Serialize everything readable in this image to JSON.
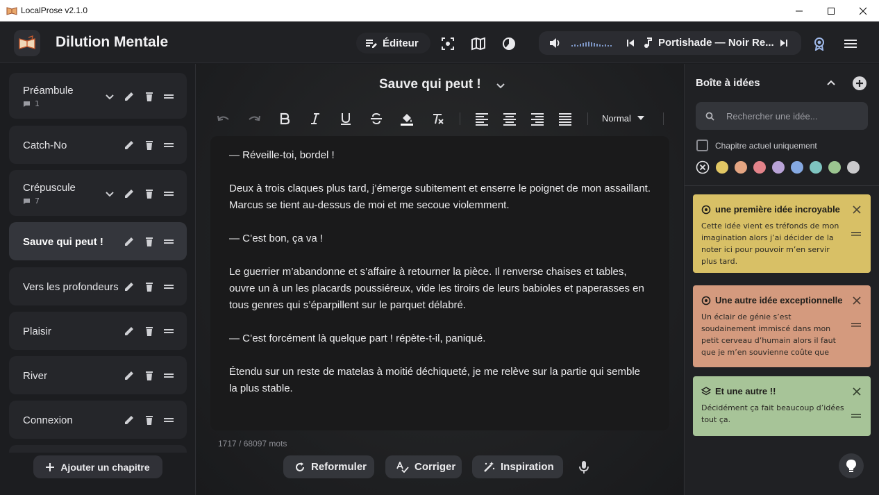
{
  "window": {
    "title": "LocalProse v2.1.0"
  },
  "header": {
    "project_title": "Dilution Mentale",
    "editor_label": "Éditeur",
    "player": {
      "track": "Portishade — Noir Re..."
    }
  },
  "sidebar": {
    "chapters": [
      {
        "name": "Préambule",
        "count": "1",
        "expandable": true
      },
      {
        "name": "Catch-No",
        "count": null,
        "expandable": false
      },
      {
        "name": "Crépuscule",
        "count": "7",
        "expandable": true
      },
      {
        "name": "Sauve qui peut !",
        "count": null,
        "expandable": false,
        "active": true
      },
      {
        "name": "Vers les profondeurs",
        "count": null,
        "expandable": false
      },
      {
        "name": "Plaisir",
        "count": null,
        "expandable": false
      },
      {
        "name": "River",
        "count": null,
        "expandable": false
      },
      {
        "name": "Connexion",
        "count": null,
        "expandable": false
      }
    ],
    "add_chapter_label": "Ajouter un chapitre"
  },
  "editor": {
    "chapter_title": "Sauve qui peut !",
    "format_select": "Normal",
    "paragraphs": [
      "— Réveille-toi, bordel !",
      "Deux à trois claques plus tard, j’émerge subitement et enserre le poignet de mon assaillant. Marcus se tient au-dessus de moi et me secoue violemment.",
      "— C’est bon, ça va !",
      "Le guerrier m’abandonne et s’affaire à retourner la pièce. Il renverse chaises et tables, ouvre un à un les placards poussiéreux, vide les tiroirs de leurs babioles et paperasses en tous genres qui s’éparpillent sur le parquet délabré.",
      "— C’est forcément là quelque part ! répète-t-il, paniqué.",
      "Étendu sur un reste de matelas à moitié déchiqueté, je me relève sur la partie qui semble la plus stable."
    ],
    "word_count": "1717 / 68097 mots",
    "actions": {
      "rephrase": "Reformuler",
      "correct": "Corriger",
      "inspiration": "Inspiration"
    }
  },
  "ideas_panel": {
    "title": "Boîte à idées",
    "search_placeholder": "Rechercher une idée...",
    "current_chapter_only": "Chapitre actuel uniquement",
    "colors": [
      "#e2c764",
      "#e4a582",
      "#e3838a",
      "#b9a3d7",
      "#85a9e2",
      "#7ec4c0",
      "#9bc590",
      "#c9c9cb"
    ],
    "ideas": [
      {
        "title": "une première idée incroyable",
        "body": "Cette idée vient es tréfonds de mon imagination alors j’ai décider de la noter ici pour pouvoir m’en servir plus tard.",
        "color": "#d8c066",
        "icon": "target-icon"
      },
      {
        "title": "Une autre idée exceptionnelle",
        "body": "Un éclair de génie s’est soudainement immiscé dans mon petit cerveau d’humain alors il faut que je m’en souvienne coûte que coûte",
        "color": "#d49a7e",
        "icon": "target-icon"
      },
      {
        "title": "Et une autre !!",
        "body": "Décidément ça fait beaucoup d’idées tout ça.",
        "color": "#a7c498",
        "icon": "layers-icon"
      }
    ]
  }
}
